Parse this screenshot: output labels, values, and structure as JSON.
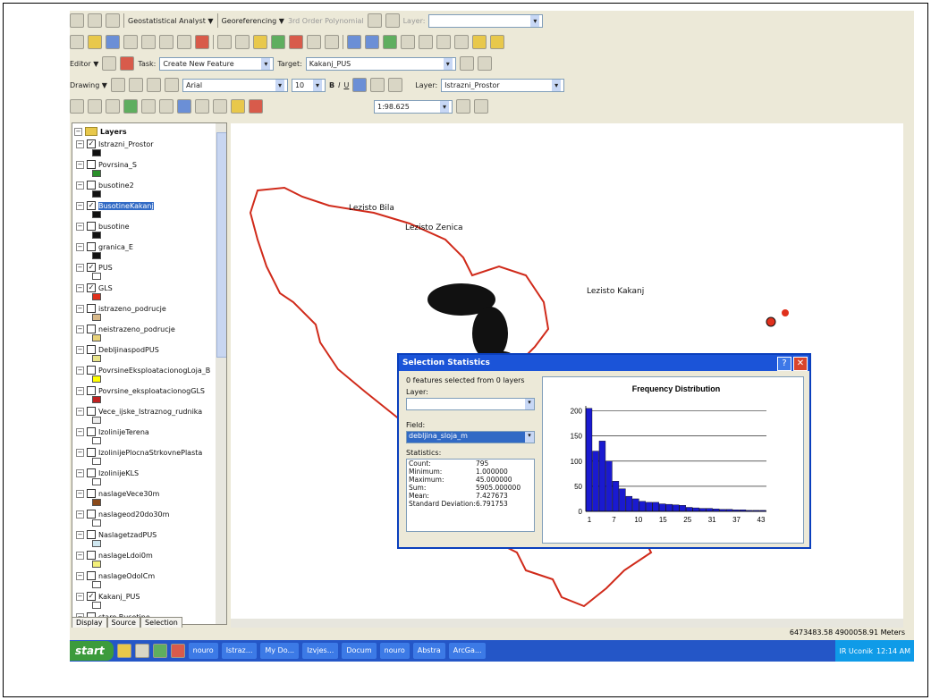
{
  "toolbar1": {
    "geostat_label": "Geostatistical Analyst ▼",
    "georef_label": "Georeferencing ▼",
    "poly_label": "3rd Order Polynomial",
    "layer_label": "Layer:"
  },
  "toolbar3": {
    "editor_label": "Editor ▼",
    "task_label": "Task:",
    "task_value": "Create New Feature",
    "target_label": "Target:",
    "target_value": "Kakanj_PUS"
  },
  "toolbar4": {
    "drawing_label": "Drawing ▼",
    "font_value": "Arial",
    "size_value": "10",
    "layer_label": "Layer:",
    "layer_value": "Istrazni_Prostor"
  },
  "toolbar5": {
    "scale_value": "1:98.625"
  },
  "toc": {
    "root_label": "Layers",
    "layers": [
      {
        "name": "Istrazni_Prostor",
        "checked": true
      },
      {
        "name": "Povrsina_S",
        "checked": false
      },
      {
        "name": "busotine2",
        "checked": false
      },
      {
        "name": "BusotineKakanj",
        "checked": true,
        "selected": true
      },
      {
        "name": "busotine",
        "checked": false
      },
      {
        "name": "granica_E",
        "checked": false
      },
      {
        "name": "PUS",
        "checked": true
      },
      {
        "name": "GLS",
        "checked": true
      },
      {
        "name": "istrazeno_podrucje",
        "checked": false
      },
      {
        "name": "neistrazeno_podrucje",
        "checked": false
      },
      {
        "name": "DebljinaspodPUS",
        "checked": false
      },
      {
        "name": "PovrsineEksploatacionogLoja_B",
        "checked": false
      },
      {
        "name": "Povrsine_eksploatacionogGLS",
        "checked": false
      },
      {
        "name": "Vece_ijske_Istraznog_rudnika",
        "checked": false
      },
      {
        "name": "IzolinijeTerena",
        "checked": false
      },
      {
        "name": "IzolinijePlocnaStrkovnePlasta",
        "checked": false
      },
      {
        "name": "IzolinijeKLS",
        "checked": false
      },
      {
        "name": "naslageVece30m",
        "checked": false
      },
      {
        "name": "naslageod20do30m",
        "checked": false
      },
      {
        "name": "NaslagetzadPUS",
        "checked": false
      },
      {
        "name": "naslageLdoi0m",
        "checked": false
      },
      {
        "name": "naslageOdolCm",
        "checked": false
      },
      {
        "name": "Kakanj_PUS",
        "checked": true
      },
      {
        "name": "stare Busotine",
        "checked": false
      }
    ]
  },
  "toc_tabs": [
    "Display",
    "Source",
    "Selection"
  ],
  "map_labels": {
    "a": "Lezisto Bila",
    "b": "Lezisto Zenica",
    "c": "Lezisto Kakanj"
  },
  "status": {
    "coords": "6473483.58 4900058.91 Meters"
  },
  "dialog": {
    "title": "Selection Statistics",
    "summary": "0 features selected from 0 layers",
    "layer_label": "Layer:",
    "layer_value": "",
    "field_label": "Field:",
    "field_value": "debljina_sloja_m",
    "stats_label": "Statistics:",
    "stats": [
      {
        "k": "Count:",
        "v": "795"
      },
      {
        "k": "Minimum:",
        "v": "1.000000"
      },
      {
        "k": "Maximum:",
        "v": "45.000000"
      },
      {
        "k": "Sum:",
        "v": "5905.000000"
      },
      {
        "k": "Mean:",
        "v": "7.427673"
      },
      {
        "k": "Standard Deviation:",
        "v": "6.791753"
      }
    ]
  },
  "chart_data": {
    "type": "bar",
    "title": "Frequency Distribution",
    "xlabel": "",
    "ylabel": "",
    "x_ticks": [
      "1",
      "7",
      "10",
      "15",
      "25",
      "31",
      "37",
      "43"
    ],
    "y_ticks": [
      0,
      50,
      100,
      150,
      200
    ],
    "ylim": [
      0,
      210
    ],
    "values": [
      205,
      120,
      140,
      100,
      60,
      45,
      30,
      25,
      20,
      18,
      18,
      15,
      14,
      13,
      12,
      8,
      7,
      6,
      6,
      5,
      4,
      4,
      3,
      3,
      2,
      2,
      2
    ],
    "bar_color": "#1a1ad0",
    "grid": true
  },
  "taskbar": {
    "start_label": "start",
    "buttons": [
      "nouro",
      "Istraz...",
      "My Do...",
      "Izvjes...",
      "Docum",
      "nouro",
      "Abstra",
      "ArcGa..."
    ],
    "tray_text": "IR  Uconik",
    "clock": "12:14 AM"
  }
}
